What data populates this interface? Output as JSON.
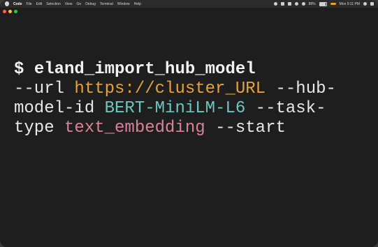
{
  "menubar": {
    "app": "Code",
    "menus": [
      "File",
      "Edit",
      "Selection",
      "View",
      "Go",
      "Debug",
      "Terminal",
      "Window",
      "Help"
    ],
    "battery_percent": "88%",
    "battery_level": 0.88,
    "clock": "Mon 9:11 PM"
  },
  "colors": {
    "url": "#e6a33a",
    "model_id": "#6cc7c0",
    "task_type": "#d9829a",
    "background": "#1e1e1e"
  },
  "terminal": {
    "prompt": "$",
    "command": "eland_import_hub_model",
    "url_flag": "--url",
    "url_value": "https://cluster_URL",
    "hub_flag_part1": "--hub-",
    "hub_flag_part2": "model-id",
    "model_value": "BERT-MiniLM-L6",
    "task_flag_part1": "--task-",
    "task_flag_part2": "type",
    "task_value": "text_embedding",
    "start_flag": "--start"
  }
}
